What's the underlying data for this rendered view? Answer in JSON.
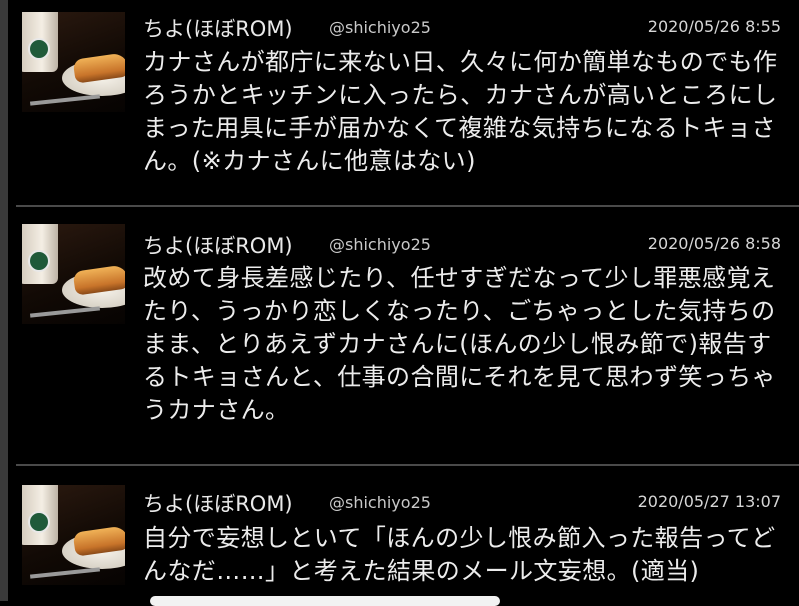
{
  "tweets": [
    {
      "name": "ちよ(ほぼROM)",
      "handle": "@shichiyo25",
      "timestamp": "2020/05/26 8:55",
      "text": "カナさんが都庁に来ない日、久々に何か簡単なものでも作ろうかとキッチンに入ったら、カナさんが高いところにしまった用具に手が届かなくて複雑な気持ちになるトキョさん。(※カナさんに他意はない)"
    },
    {
      "name": "ちよ(ほぼROM)",
      "handle": "@shichiyo25",
      "timestamp": "2020/05/26 8:58",
      "text": "改めて身長差感じたり、任せすぎだなって少し罪悪感覚えたり、うっかり恋しくなったり、ごちゃっとした気持ちのまま、とりあえずカナさんに(ほんの少し恨み節で)報告するトキョさんと、仕事の合間にそれを見て思わず笑っちゃうカナさん。"
    },
    {
      "name": "ちよ(ほぼROM)",
      "handle": "@shichiyo25",
      "timestamp": "2020/05/27 13:07",
      "text": "自分で妄想しといて「ほんの少し恨み節入った報告ってどんなだ……」と考えた結果のメール文妄想。(適当)"
    }
  ],
  "colors": {
    "background": "#000000",
    "text": "#ececec",
    "divider": "#4a4a4a"
  }
}
